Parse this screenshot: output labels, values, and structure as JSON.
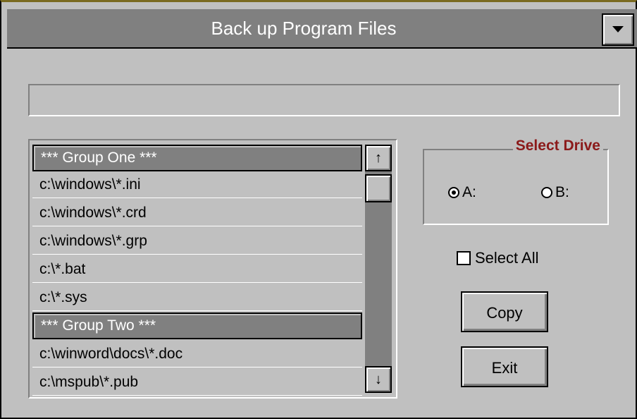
{
  "window": {
    "title": "Back up Program Files"
  },
  "status_text": "",
  "file_list": {
    "items": [
      {
        "label": "*** Group One ***",
        "is_group": true
      },
      {
        "label": "c:\\windows\\*.ini",
        "is_group": false
      },
      {
        "label": "c:\\windows\\*.crd",
        "is_group": false
      },
      {
        "label": "c:\\windows\\*.grp",
        "is_group": false
      },
      {
        "label": "c:\\*.bat",
        "is_group": false
      },
      {
        "label": "c:\\*.sys",
        "is_group": false
      },
      {
        "label": "*** Group Two ***",
        "is_group": true
      },
      {
        "label": "c:\\winword\\docs\\*.doc",
        "is_group": false
      },
      {
        "label": "c:\\mspub\\*.pub",
        "is_group": false
      }
    ],
    "scroll_up_glyph": "↑",
    "scroll_down_glyph": "↓"
  },
  "select_drive": {
    "title": "Select Drive",
    "options": [
      {
        "label": "A:",
        "selected": true
      },
      {
        "label": "B:",
        "selected": false
      }
    ]
  },
  "select_all": {
    "label": "Select All",
    "checked": false
  },
  "buttons": {
    "copy": "Copy",
    "exit": "Exit"
  },
  "colors": {
    "title_bar": "#808080",
    "group_title": "#8b1a1a",
    "face": "#c0c0c0"
  }
}
